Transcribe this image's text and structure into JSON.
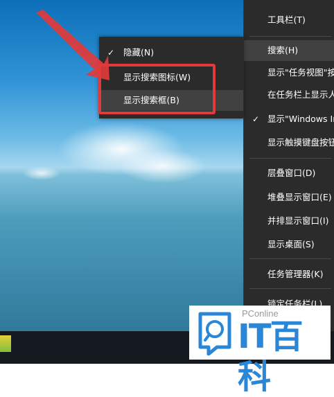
{
  "submenu": {
    "items": [
      {
        "label": "隐藏(N)",
        "checked": true
      },
      {
        "label": "显示搜索图标(W)",
        "checked": false
      },
      {
        "label": "显示搜索框(B)",
        "checked": false
      }
    ]
  },
  "context_menu": {
    "items": [
      {
        "label": "工具栏(T)"
      },
      {
        "label": "搜索(H)"
      },
      {
        "label": "显示\"任务视图\"按"
      },
      {
        "label": "在任务栏上显示人"
      },
      {
        "label": "显示\"Windows In",
        "checked": true
      },
      {
        "label": "显示触摸键盘按钮"
      },
      {
        "label": "层叠窗口(D)"
      },
      {
        "label": "堆叠显示窗口(E)"
      },
      {
        "label": "并排显示窗口(I)"
      },
      {
        "label": "显示桌面(S)"
      },
      {
        "label": "任务管理器(K)"
      },
      {
        "label": "锁定任务栏(L)"
      }
    ]
  },
  "watermark": {
    "brand_small": "PConline",
    "brand_big": "IT百科"
  },
  "colors": {
    "menu_bg": "#2b2b2b",
    "highlight": "#414141",
    "annotation_red": "#e23a3a",
    "brand_blue": "#2a86d6"
  }
}
